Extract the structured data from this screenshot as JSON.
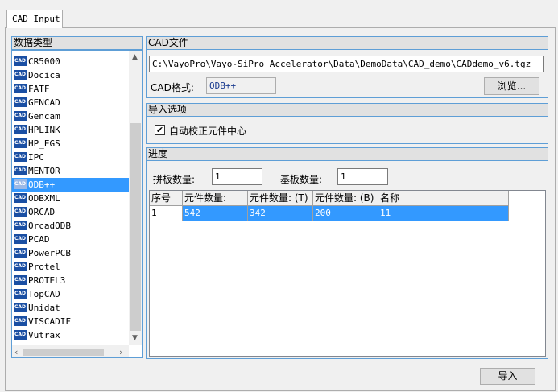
{
  "tab": {
    "label": "CAD Input"
  },
  "data_type": {
    "header": "数据类型",
    "selected": "ODB++",
    "items": [
      "CR5000",
      "Docica",
      "FATF",
      "GENCAD",
      "Gencam",
      "HPLINK",
      "HP_EGS",
      "IPC",
      "MENTOR",
      "ODB++",
      "ODBXML",
      "ORCAD",
      "OrcadODB",
      "PCAD",
      "PowerPCB",
      "Protel",
      "PROTEL3",
      "TopCAD",
      "Unidat",
      "VISCADIF",
      "Vutrax"
    ],
    "icon_text": "CAD"
  },
  "cad_file": {
    "header": "CAD文件",
    "path": "C:\\VayoPro\\Vayo-SiPro Accelerator\\Data\\DemoData\\CAD_demo\\CADdemo_v6.tgz",
    "format_label": "CAD格式:",
    "format_value": "ODB++",
    "browse_label": "浏览..."
  },
  "import_options": {
    "header": "导入选项",
    "auto_center_label": "自动校正元件中心",
    "auto_center_checked": true
  },
  "progress": {
    "header": "进度",
    "panel_count_label": "拼板数量:",
    "panel_count": "1",
    "substrate_count_label": "基板数量:",
    "substrate_count": "1",
    "columns": [
      "序号",
      "元件数量:",
      "元件数量: (T)",
      "元件数量: (B)",
      "名称"
    ],
    "rows": [
      [
        "1",
        "542",
        "342",
        "200",
        "11"
      ]
    ]
  },
  "import_button": {
    "label": "导入"
  },
  "colors": {
    "accent_border": "#5e9ed6",
    "selection": "#3399ff"
  }
}
